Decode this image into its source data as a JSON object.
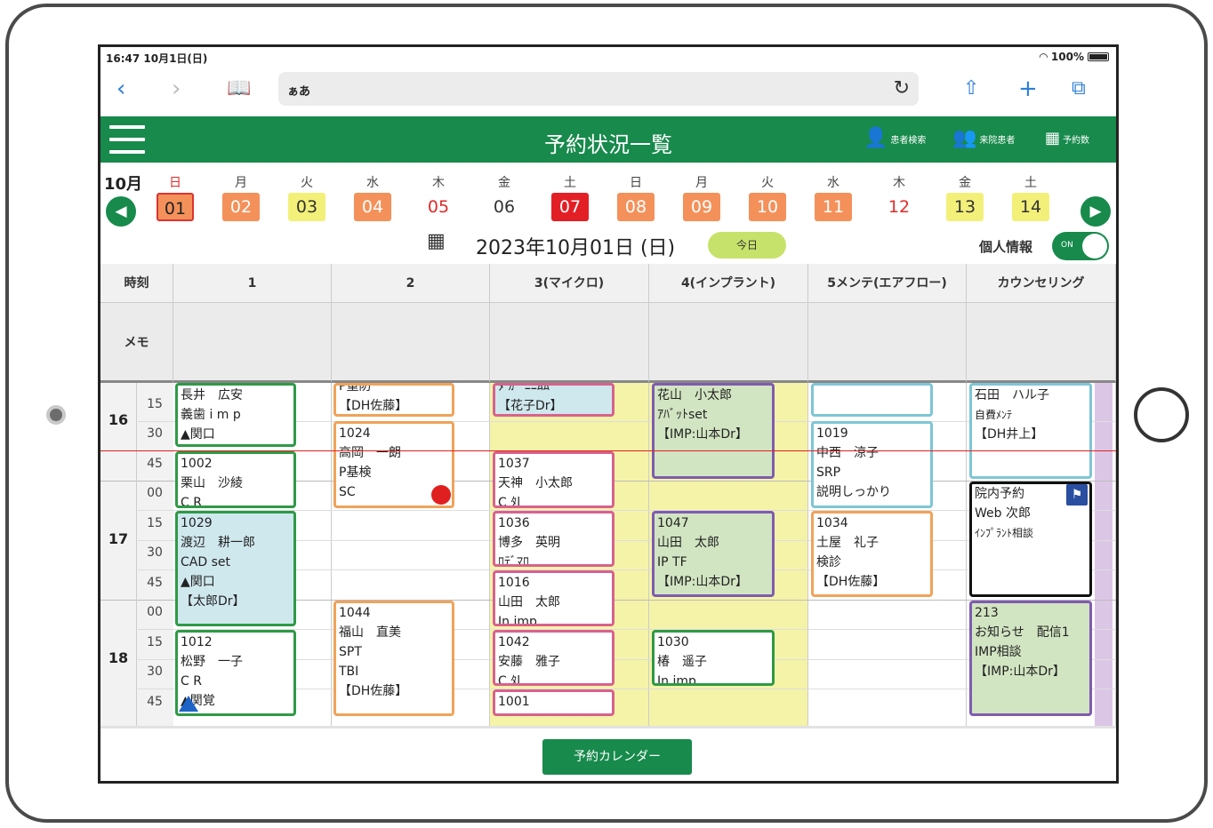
{
  "status": {
    "time": "16:47 10月1日(日)",
    "battery": "100%"
  },
  "browser": {
    "address": "ぁあ"
  },
  "header": {
    "title": "予約状況一覧",
    "patient_search": "患者検索",
    "visiting_patients": "来院患者",
    "reservation_count": "予約数"
  },
  "dates": {
    "month": "10月",
    "days": [
      {
        "w": "日",
        "d": "01"
      },
      {
        "w": "月",
        "d": "02"
      },
      {
        "w": "火",
        "d": "03"
      },
      {
        "w": "水",
        "d": "04"
      },
      {
        "w": "木",
        "d": "05"
      },
      {
        "w": "金",
        "d": "06"
      },
      {
        "w": "土",
        "d": "07"
      },
      {
        "w": "日",
        "d": "08"
      },
      {
        "w": "月",
        "d": "09"
      },
      {
        "w": "火",
        "d": "10"
      },
      {
        "w": "水",
        "d": "11"
      },
      {
        "w": "木",
        "d": "12"
      },
      {
        "w": "金",
        "d": "13"
      },
      {
        "w": "土",
        "d": "14"
      }
    ],
    "full_date": "2023年10月01日 (日)",
    "today_label": "今日",
    "privacy_label": "個人情報",
    "toggle_state": "ON"
  },
  "columns": {
    "time": "時刻",
    "c1": "1",
    "c2": "2",
    "c3": "3(マイクロ)",
    "c4": "4(インプラント)",
    "c5": "5メンテ(エアフロー)",
    "c6": "カウンセリング"
  },
  "memo_label": "メモ",
  "hours": [
    "16",
    "17",
    "18"
  ],
  "minutes": [
    "15",
    "30",
    "45",
    "00",
    "15",
    "30",
    "45",
    "00",
    "15",
    "30",
    "45"
  ],
  "appointments": {
    "a1": [
      "長井　広安",
      "義歯 i m p",
      "▲関口"
    ],
    "a2": [
      "1002",
      "栗山　沙綾",
      "C R"
    ],
    "a3": [
      "1029",
      "渡辺　耕一郎",
      "CAD set",
      "▲関口",
      "【太郎Dr】"
    ],
    "a4": [
      "1012",
      "松野　一子",
      "C R",
      "▲関覚"
    ],
    "b1": [
      "P重防",
      "【DH佐藤】"
    ],
    "b2": [
      "1024",
      "高岡　一朗",
      "P基検",
      "SC"
    ],
    "b3": [
      "1044",
      "福山　直美",
      "SPT",
      "TBI",
      "【DH佐藤】"
    ],
    "c1": [
      "ﾀ ｶﾞ ﾆﾆﾑﾑ",
      "【花子Dr】"
    ],
    "c2": [
      "1037",
      "天神　小太郎",
      "C ﾀl"
    ],
    "c3": [
      "1036",
      "博多　英明",
      "ﾛﾃﾞﾏﾛ"
    ],
    "c4": [
      "1016",
      "山田　太郎",
      "In imp"
    ],
    "c5": [
      "1042",
      "安藤　雅子",
      "C ﾀl"
    ],
    "c6": [
      "1001"
    ],
    "d1": [
      "花山　小太郎",
      "ｱﾊﾞｯﾄset",
      "【IMP:山本Dr】"
    ],
    "d2": [
      "1047",
      "山田　太郎",
      "IP TF",
      "【IMP:山本Dr】"
    ],
    "d3": [
      "1030",
      "椿　遥子",
      "In imp"
    ],
    "e2": [
      "1019",
      "中西　涼子",
      "SRP",
      "説明しっかり"
    ],
    "e3": [
      "1034",
      "土屋　礼子",
      "検診",
      "【DH佐藤】"
    ],
    "f1": [
      "石田　ハル子",
      "自費ﾒﾝﾃ",
      "【DH井上】"
    ],
    "f2": [
      "院内予約",
      "Web 次郎",
      "ｲﾝﾌﾟﾗﾝﾄ相談"
    ],
    "f3": [
      "213",
      "お知らせ　配信1",
      "IMP相談",
      "【IMP:山本Dr】"
    ]
  },
  "footer": {
    "calendar_button": "予約カレンダー"
  },
  "colors": {
    "brand_green": "#178a4c",
    "now_line": "#e02020"
  }
}
